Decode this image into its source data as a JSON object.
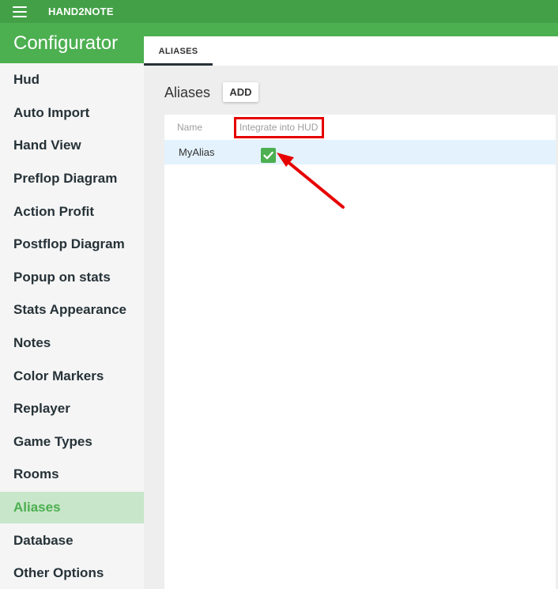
{
  "app": {
    "title": "HAND2NOTE"
  },
  "sidebar": {
    "header": "Configurator",
    "items": [
      {
        "label": "Hud"
      },
      {
        "label": "Auto Import"
      },
      {
        "label": "Hand View"
      },
      {
        "label": "Preflop Diagram"
      },
      {
        "label": "Action Profit"
      },
      {
        "label": "Postflop Diagram"
      },
      {
        "label": "Popup on stats"
      },
      {
        "label": "Stats Appearance"
      },
      {
        "label": "Notes"
      },
      {
        "label": "Color Markers"
      },
      {
        "label": "Replayer"
      },
      {
        "label": "Game Types"
      },
      {
        "label": "Rooms"
      },
      {
        "label": "Aliases",
        "active": true
      },
      {
        "label": "Database"
      },
      {
        "label": "Other Options"
      }
    ]
  },
  "tabs": [
    {
      "label": "ALIASES",
      "active": true
    }
  ],
  "main": {
    "title": "Aliases",
    "add_label": "ADD",
    "table": {
      "columns": [
        "Name",
        "Integrate into HUD"
      ],
      "rows": [
        {
          "name": "MyAlias",
          "integrate": true
        }
      ]
    }
  },
  "colors": {
    "accent": "#4caf50",
    "topbar": "#43a047",
    "active_item_bg": "#c8e6c9",
    "selected_row_bg": "#e3f2fd",
    "annotation": "#e60000"
  }
}
